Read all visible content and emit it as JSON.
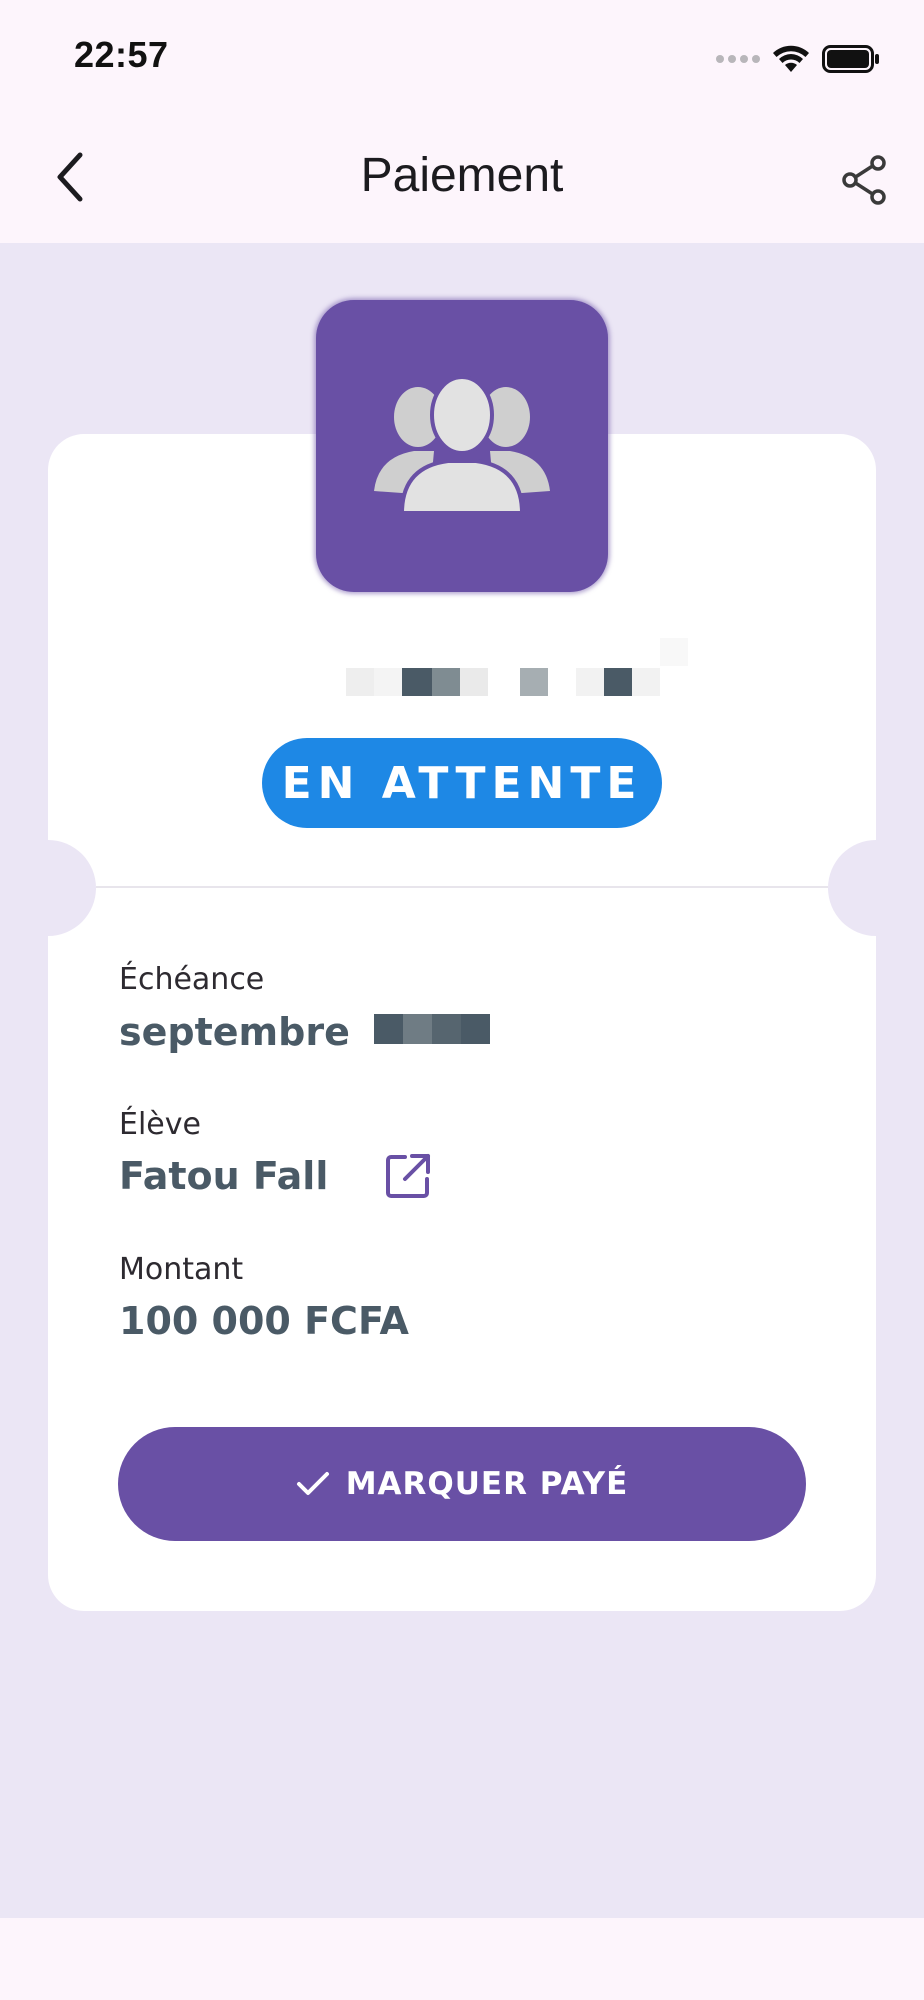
{
  "status_bar": {
    "time": "22:57",
    "icons": [
      "signal-dots-icon",
      "wifi-icon",
      "battery-icon"
    ]
  },
  "app_bar": {
    "title": "Paiement",
    "back_icon": "chevron-left-icon",
    "share_icon": "share-icon"
  },
  "payment": {
    "avatar_icon": "group-users-icon",
    "status": "EN ATTENTE",
    "fields": {
      "due_label": "Échéance",
      "due_value": "septembre",
      "student_label": "Élève",
      "student_value": "Fatou Fall",
      "amount_label": "Montant",
      "amount_value": "100 000 FCFA"
    },
    "action_label": "MARQUER PAYÉ"
  },
  "colors": {
    "primary": "#6950a5",
    "status_pending": "#1e88e5",
    "page_background": "#ebe6f5",
    "bar_background": "#fdf5fc",
    "value_text": "#4a5a66"
  }
}
